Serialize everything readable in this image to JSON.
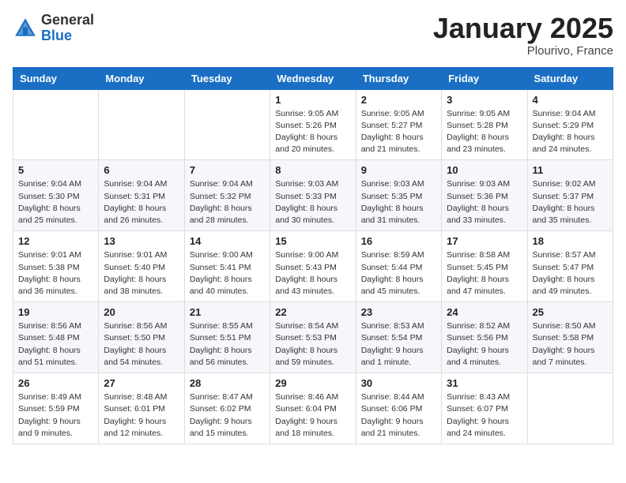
{
  "header": {
    "logo": {
      "general": "General",
      "blue": "Blue"
    },
    "month": "January 2025",
    "location": "Plourivo, France"
  },
  "weekdays": [
    "Sunday",
    "Monday",
    "Tuesday",
    "Wednesday",
    "Thursday",
    "Friday",
    "Saturday"
  ],
  "weeks": [
    [
      {
        "day": "",
        "sunrise": "",
        "sunset": "",
        "daylight": ""
      },
      {
        "day": "",
        "sunrise": "",
        "sunset": "",
        "daylight": ""
      },
      {
        "day": "",
        "sunrise": "",
        "sunset": "",
        "daylight": ""
      },
      {
        "day": "1",
        "sunrise": "9:05 AM",
        "sunset": "5:26 PM",
        "daylight": "8 hours and 20 minutes."
      },
      {
        "day": "2",
        "sunrise": "9:05 AM",
        "sunset": "5:27 PM",
        "daylight": "8 hours and 21 minutes."
      },
      {
        "day": "3",
        "sunrise": "9:05 AM",
        "sunset": "5:28 PM",
        "daylight": "8 hours and 23 minutes."
      },
      {
        "day": "4",
        "sunrise": "9:04 AM",
        "sunset": "5:29 PM",
        "daylight": "8 hours and 24 minutes."
      }
    ],
    [
      {
        "day": "5",
        "sunrise": "9:04 AM",
        "sunset": "5:30 PM",
        "daylight": "8 hours and 25 minutes."
      },
      {
        "day": "6",
        "sunrise": "9:04 AM",
        "sunset": "5:31 PM",
        "daylight": "8 hours and 26 minutes."
      },
      {
        "day": "7",
        "sunrise": "9:04 AM",
        "sunset": "5:32 PM",
        "daylight": "8 hours and 28 minutes."
      },
      {
        "day": "8",
        "sunrise": "9:03 AM",
        "sunset": "5:33 PM",
        "daylight": "8 hours and 30 minutes."
      },
      {
        "day": "9",
        "sunrise": "9:03 AM",
        "sunset": "5:35 PM",
        "daylight": "8 hours and 31 minutes."
      },
      {
        "day": "10",
        "sunrise": "9:03 AM",
        "sunset": "5:36 PM",
        "daylight": "8 hours and 33 minutes."
      },
      {
        "day": "11",
        "sunrise": "9:02 AM",
        "sunset": "5:37 PM",
        "daylight": "8 hours and 35 minutes."
      }
    ],
    [
      {
        "day": "12",
        "sunrise": "9:01 AM",
        "sunset": "5:38 PM",
        "daylight": "8 hours and 36 minutes."
      },
      {
        "day": "13",
        "sunrise": "9:01 AM",
        "sunset": "5:40 PM",
        "daylight": "8 hours and 38 minutes."
      },
      {
        "day": "14",
        "sunrise": "9:00 AM",
        "sunset": "5:41 PM",
        "daylight": "8 hours and 40 minutes."
      },
      {
        "day": "15",
        "sunrise": "9:00 AM",
        "sunset": "5:43 PM",
        "daylight": "8 hours and 43 minutes."
      },
      {
        "day": "16",
        "sunrise": "8:59 AM",
        "sunset": "5:44 PM",
        "daylight": "8 hours and 45 minutes."
      },
      {
        "day": "17",
        "sunrise": "8:58 AM",
        "sunset": "5:45 PM",
        "daylight": "8 hours and 47 minutes."
      },
      {
        "day": "18",
        "sunrise": "8:57 AM",
        "sunset": "5:47 PM",
        "daylight": "8 hours and 49 minutes."
      }
    ],
    [
      {
        "day": "19",
        "sunrise": "8:56 AM",
        "sunset": "5:48 PM",
        "daylight": "8 hours and 51 minutes."
      },
      {
        "day": "20",
        "sunrise": "8:56 AM",
        "sunset": "5:50 PM",
        "daylight": "8 hours and 54 minutes."
      },
      {
        "day": "21",
        "sunrise": "8:55 AM",
        "sunset": "5:51 PM",
        "daylight": "8 hours and 56 minutes."
      },
      {
        "day": "22",
        "sunrise": "8:54 AM",
        "sunset": "5:53 PM",
        "daylight": "8 hours and 59 minutes."
      },
      {
        "day": "23",
        "sunrise": "8:53 AM",
        "sunset": "5:54 PM",
        "daylight": "9 hours and 1 minute."
      },
      {
        "day": "24",
        "sunrise": "8:52 AM",
        "sunset": "5:56 PM",
        "daylight": "9 hours and 4 minutes."
      },
      {
        "day": "25",
        "sunrise": "8:50 AM",
        "sunset": "5:58 PM",
        "daylight": "9 hours and 7 minutes."
      }
    ],
    [
      {
        "day": "26",
        "sunrise": "8:49 AM",
        "sunset": "5:59 PM",
        "daylight": "9 hours and 9 minutes."
      },
      {
        "day": "27",
        "sunrise": "8:48 AM",
        "sunset": "6:01 PM",
        "daylight": "9 hours and 12 minutes."
      },
      {
        "day": "28",
        "sunrise": "8:47 AM",
        "sunset": "6:02 PM",
        "daylight": "9 hours and 15 minutes."
      },
      {
        "day": "29",
        "sunrise": "8:46 AM",
        "sunset": "6:04 PM",
        "daylight": "9 hours and 18 minutes."
      },
      {
        "day": "30",
        "sunrise": "8:44 AM",
        "sunset": "6:06 PM",
        "daylight": "9 hours and 21 minutes."
      },
      {
        "day": "31",
        "sunrise": "8:43 AM",
        "sunset": "6:07 PM",
        "daylight": "9 hours and 24 minutes."
      },
      {
        "day": "",
        "sunrise": "",
        "sunset": "",
        "daylight": ""
      }
    ]
  ]
}
